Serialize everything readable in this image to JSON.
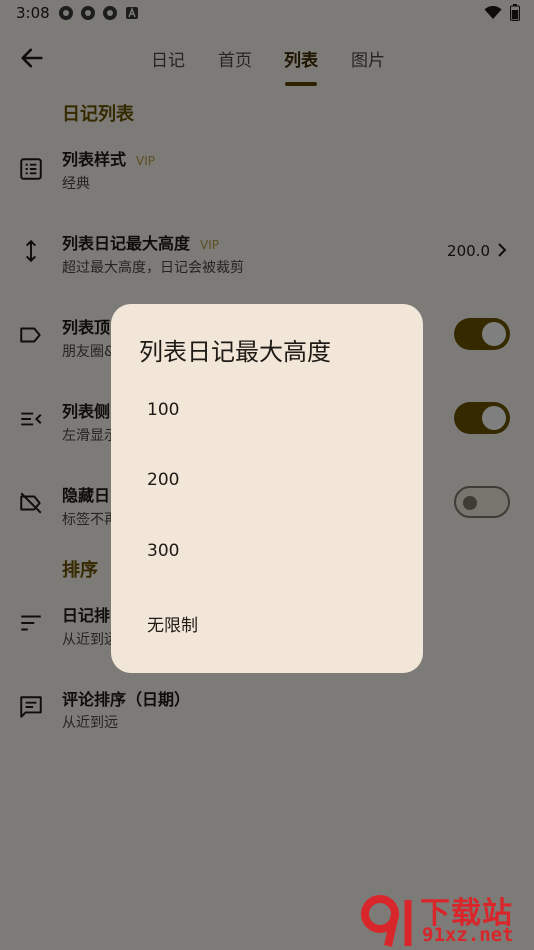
{
  "status": {
    "time": "3:08"
  },
  "tabs": [
    {
      "label": "日记"
    },
    {
      "label": "首页"
    },
    {
      "label": "列表"
    },
    {
      "label": "图片"
    }
  ],
  "sections": {
    "list": "日记列表",
    "sort": "排序"
  },
  "rows": {
    "style": {
      "title": "列表样式",
      "vip": "VIP",
      "sub": "经典"
    },
    "maxh": {
      "title": "列表日记最大高度",
      "vip": "VIP",
      "sub": "超过最大高度，日记会被裁剪",
      "value": "200.0"
    },
    "top": {
      "title": "列表顶",
      "sub": "朋友圈&"
    },
    "side": {
      "title": "列表侧",
      "sub": "左滑显示"
    },
    "hide": {
      "title": "隐藏日",
      "sub": "标签不再"
    },
    "diarysort": {
      "title": "日记排",
      "sub": "从近到远"
    },
    "commentsort": {
      "title": "评论排序（日期）",
      "sub": "从近到远"
    }
  },
  "toggles": {
    "top": true,
    "side": true,
    "hide": false
  },
  "dialog": {
    "title": "列表日记最大高度",
    "options": [
      "100",
      "200",
      "300",
      "无限制"
    ]
  },
  "watermark": {
    "top": "下载站",
    "url": "91xz.net"
  },
  "colors": {
    "accent": "#6b5200",
    "vip": "#b7a042",
    "dialog_bg": "#f2e6d9"
  }
}
